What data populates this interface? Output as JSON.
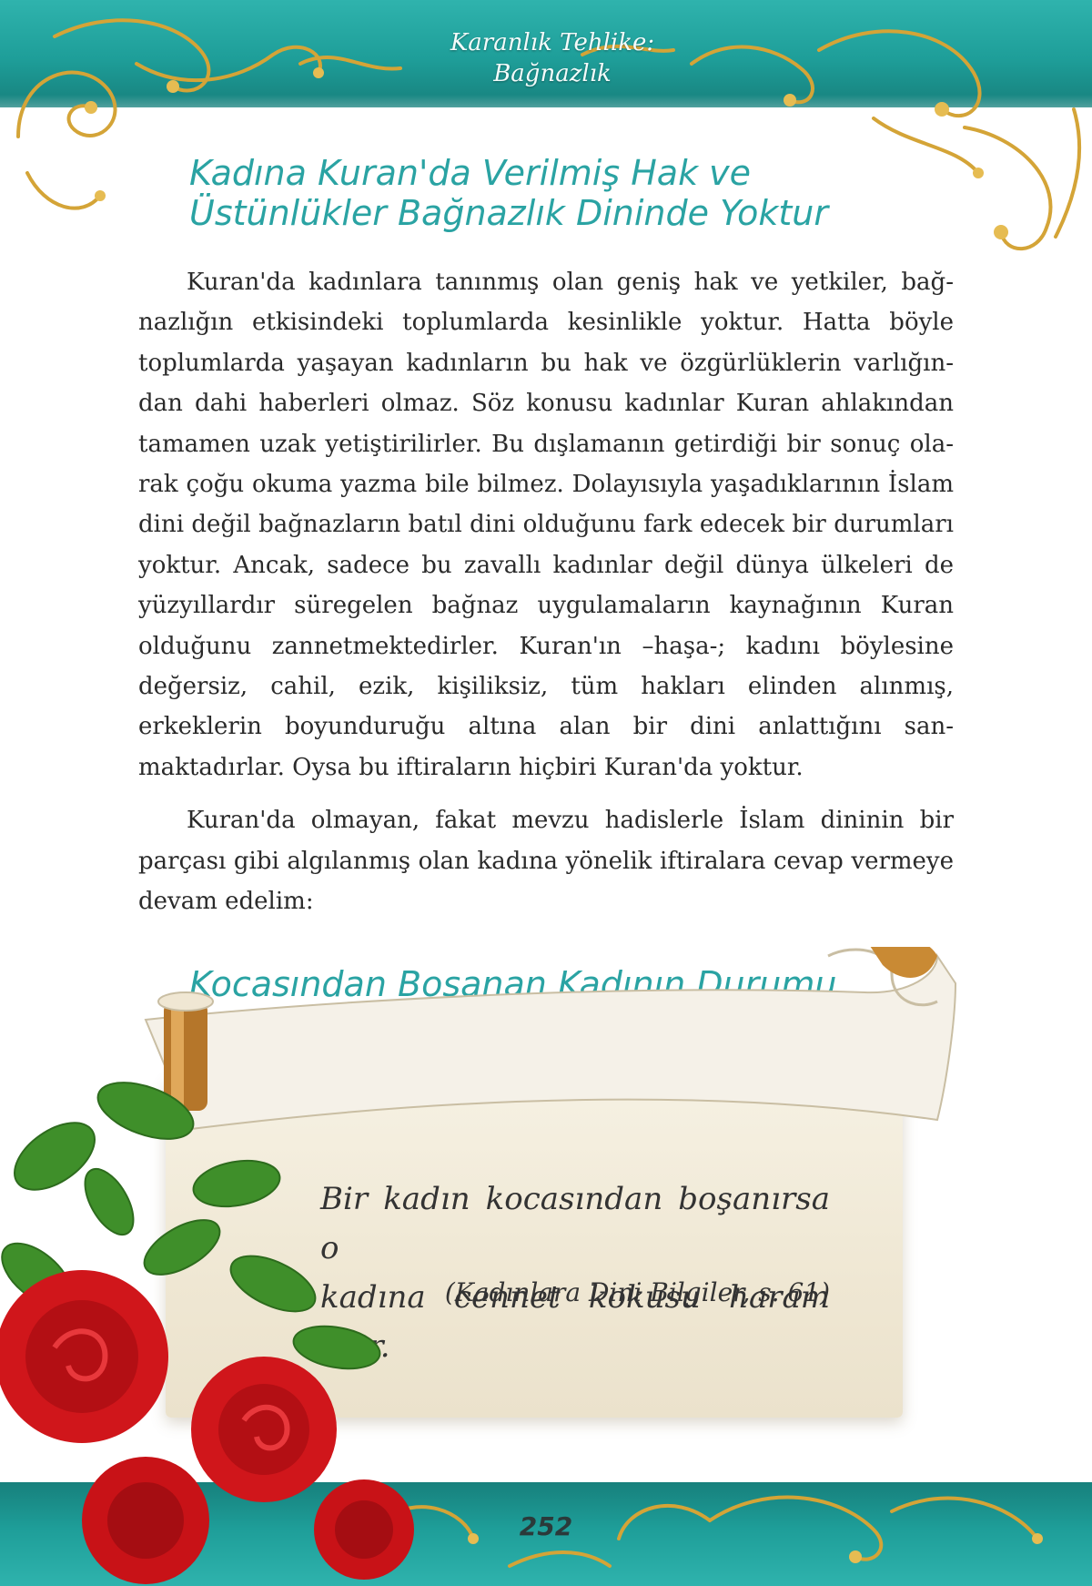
{
  "header": {
    "running_head_line1": "Karanlık Tehlike:",
    "running_head_line2": "Bağnazlık"
  },
  "section": {
    "title_line1": "Kadına Kuran'da Verilmiş Hak ve",
    "title_line2": "Üstünlükler Bağnazlık Dininde Yoktur",
    "paragraphs": [
      "Kuran'da kadınlara tanınmış olan geniş hak ve yetkiler, bağ­nazlığın etkisindeki toplumlarda kesinlikle yoktur. Hatta böyle toplumlarda yaşayan kadınların bu hak ve özgürlüklerin varlığın­dan dahi haberleri olmaz. Söz konusu kadınlar Kuran ahlakından tamamen uzak yetiştirilirler. Bu dışlamanın getirdiği bir sonuç ola­rak çoğu okuma yazma bile bilmez. Dolayısıyla yaşadıklarının İslam dini değil bağnazların batıl dini olduğunu fark edecek bir durumları yoktur. Ancak, sadece bu zavallı kadınlar değil dünya ülkeleri de yüzyıllardır süregelen bağnaz uygulamaların kaynağı­nın Kuran olduğunu zannetmektedirler. Kuran'ın –haşa-; kadını böylesine değersiz, cahil, ezik, kişiliksiz, tüm hakları elinden alın­mış, erkeklerin boyunduruğu altına alan bir dini anlattığını san­maktadırlar. Oysa bu iftiraların hiçbiri Kuran'da yoktur.",
      "Kuran'da olmayan, fakat mevzu hadislerle İslam dininin bir parçası gibi algılanmış olan kadına yönelik iftiralara cevap verme­ye devam edelim:"
    ]
  },
  "subsection": {
    "title": "Kocasından Boşanan Kadının Durumu",
    "quote_line1": "Bir kadın kocasından boşanırsa o",
    "quote_line2": "kadına cennet kokusu haram olur.",
    "citation": "(Kadınlara Dini Bilgiler, s. 61)"
  },
  "footer": {
    "page_number": "252"
  },
  "colors": {
    "teal_band": "#1e9e99",
    "title_teal": "#2aa3a3",
    "gold_ornament": "#d4a437",
    "rose_red": "#d0161b",
    "leaf_green": "#3f8f2a"
  },
  "decor_icons": [
    "gold-scroll-ornament-icon",
    "parchment-scroll-icon",
    "red-roses-icon"
  ]
}
